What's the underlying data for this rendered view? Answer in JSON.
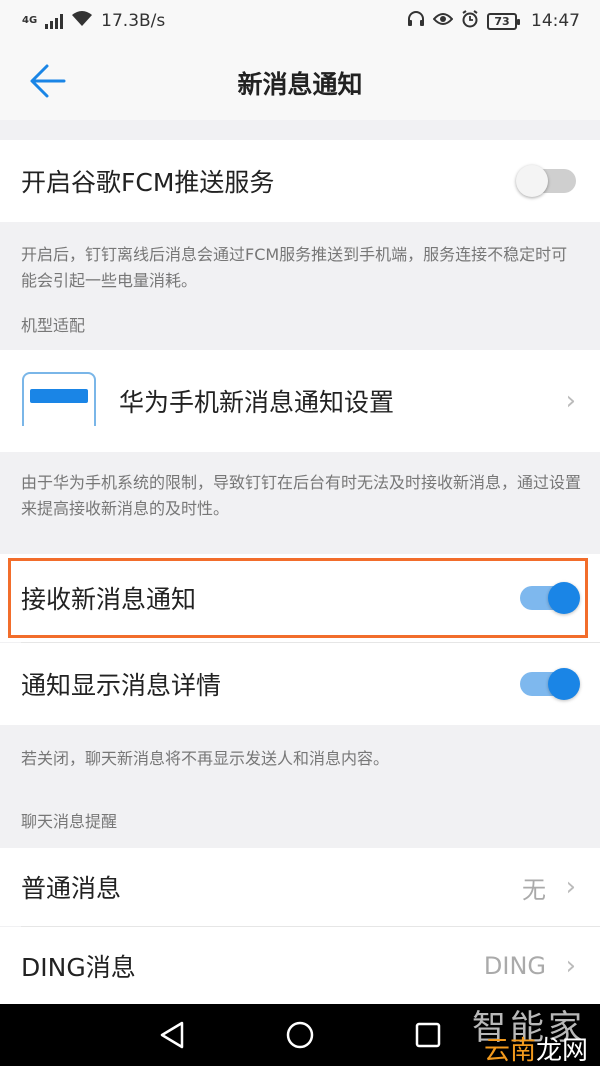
{
  "status_bar": {
    "network_type": "4G",
    "speed": "17.3B/s",
    "battery": "73",
    "time": "14:47",
    "icons": [
      "headphones-icon",
      "eye-icon",
      "alarm-icon"
    ]
  },
  "header": {
    "title": "新消息通知",
    "back_icon": "back-arrow-icon",
    "accent_color": "#1a85e6"
  },
  "fcm": {
    "label": "开启谷歌FCM推送服务",
    "enabled": false,
    "description": "开启后，钉钉离线后消息会通过FCM服务推送到手机端，服务连接不稳定时可能会引起一些电量消耗。"
  },
  "device_section": {
    "label": "机型适配",
    "item_label": "华为手机新消息通知设置",
    "item_icon": "phone-screen-icon",
    "description": "由于华为手机系统的限制，导致钉钉在后台有时无法及时接收新消息，通过设置来提高接收新消息的及时性。"
  },
  "notifications": {
    "receive_label": "接收新消息通知",
    "receive_enabled": true,
    "detail_label": "通知显示消息详情",
    "detail_enabled": true,
    "description": "若关闭，聊天新消息将不再显示发送人和消息内容。"
  },
  "chat_alerts": {
    "label": "聊天消息提醒",
    "items": [
      {
        "label": "普通消息",
        "value": "无"
      },
      {
        "label": "DING消息",
        "value": "DING"
      }
    ]
  },
  "system_nav": {
    "icons": [
      "back-triangle-icon",
      "home-circle-icon",
      "recents-square-icon"
    ]
  },
  "watermark": {
    "top": "智能家",
    "bottom_a": "云南",
    "bottom_b": "龙网"
  }
}
